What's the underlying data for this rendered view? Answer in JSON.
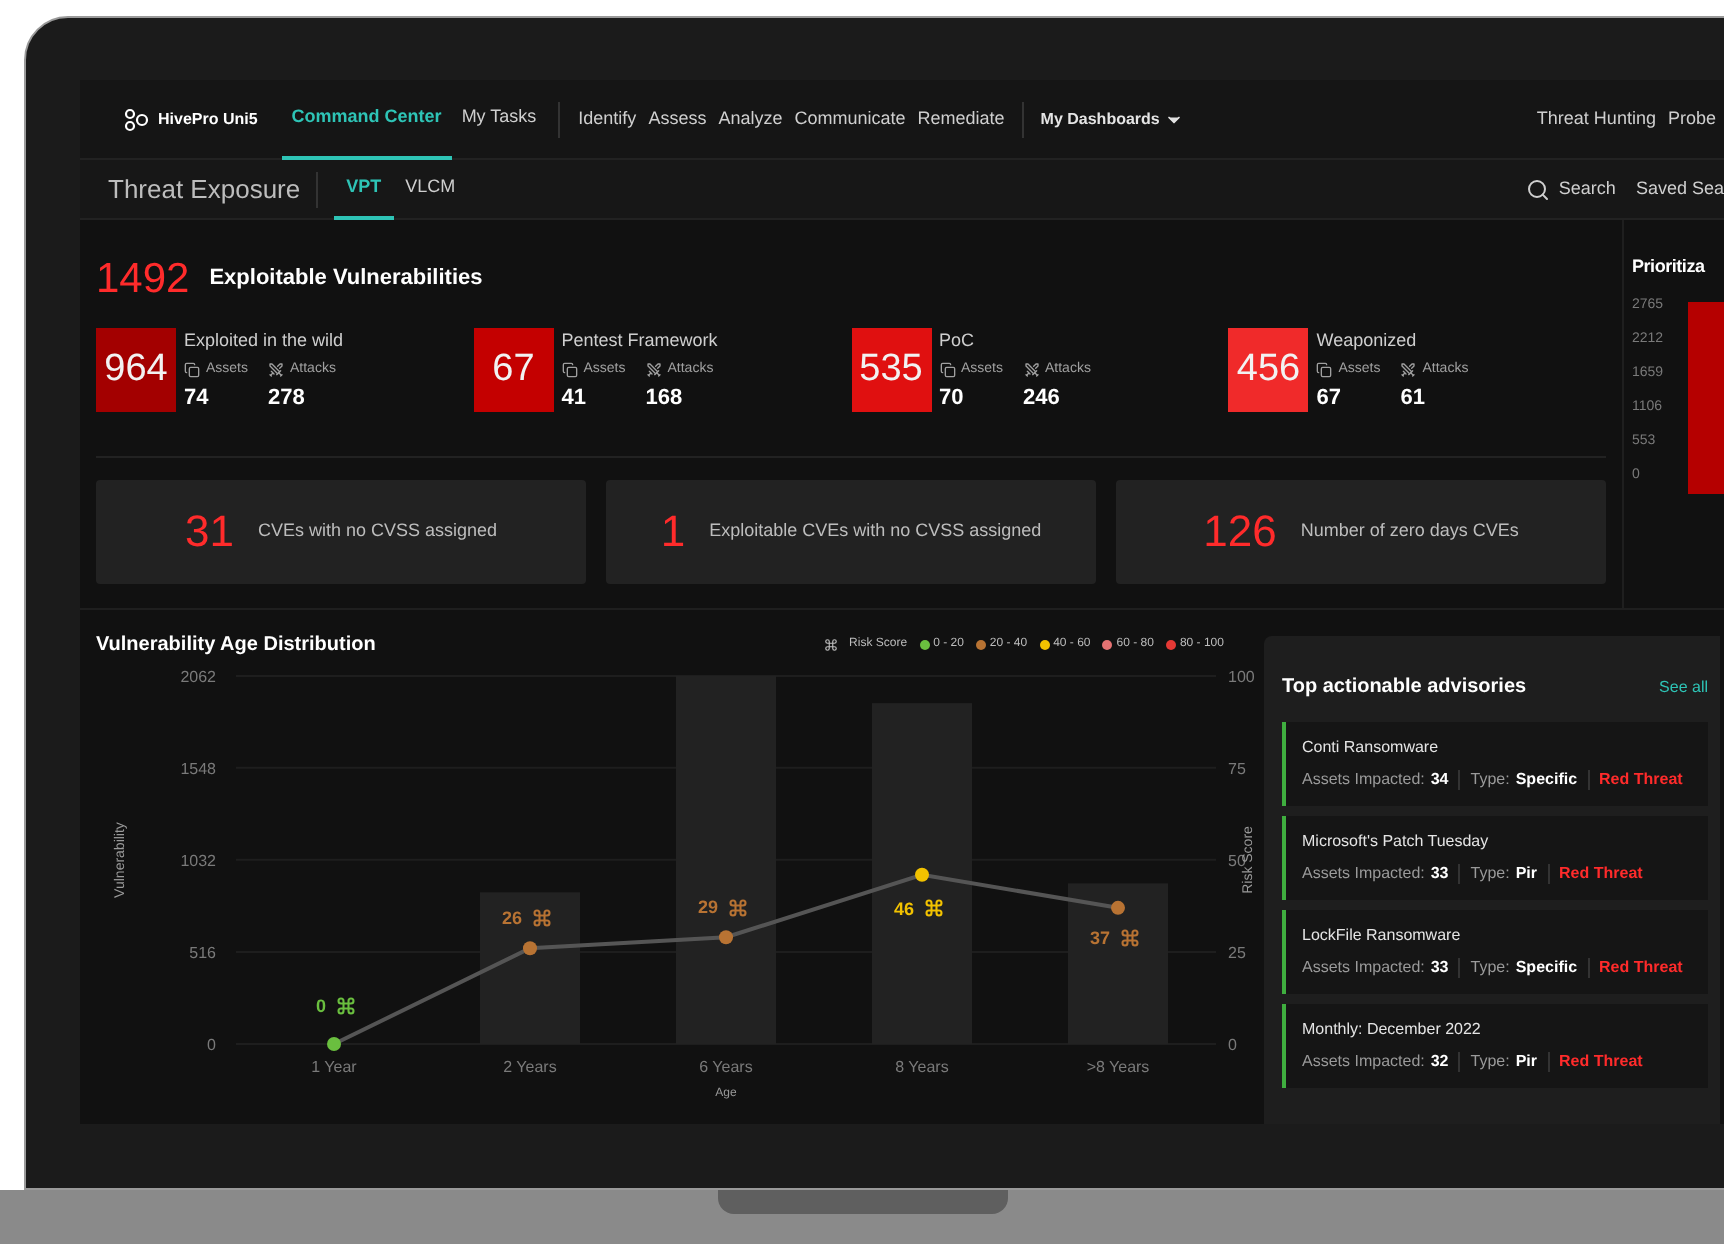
{
  "nav": {
    "brand": "HivePro Uni5",
    "tabs": [
      {
        "label": "Command Center",
        "selected": true
      },
      {
        "label": "My Tasks",
        "selected": false
      }
    ],
    "modules": [
      "Identify",
      "Assess",
      "Analyze",
      "Communicate",
      "Remediate"
    ],
    "dashboards": "My Dashboards",
    "right_links": [
      "Threat Hunting",
      "Probe"
    ]
  },
  "subnav": {
    "title": "Threat Exposure",
    "tabs": [
      {
        "label": "VPT",
        "selected": true
      },
      {
        "label": "VLCM",
        "selected": false
      }
    ],
    "search": "Search",
    "saved": "Saved Sea"
  },
  "summary": {
    "total": "1492",
    "title": "Exploitable Vulnerabilities",
    "cards": [
      {
        "count": "964",
        "label": "Exploited in the wild",
        "assets_label": "Assets",
        "attacks_label": "Attacks",
        "assets": "74",
        "attacks": "278",
        "color": "#a30000"
      },
      {
        "count": "67",
        "label": "Pentest Framework",
        "assets_label": "Assets",
        "attacks_label": "Attacks",
        "assets": "41",
        "attacks": "168",
        "color": "#c40000"
      },
      {
        "count": "535",
        "label": "PoC",
        "assets_label": "Assets",
        "attacks_label": "Attacks",
        "assets": "70",
        "attacks": "246",
        "color": "#e01010"
      },
      {
        "count": "456",
        "label": "Weaponized",
        "assets_label": "Assets",
        "attacks_label": "Attacks",
        "assets": "67",
        "attacks": "61",
        "color": "#f02a2a"
      }
    ],
    "stats": [
      {
        "value": "31",
        "label": "CVEs with no CVSS assigned"
      },
      {
        "value": "1",
        "label": "Exploitable CVEs with no CVSS assigned"
      },
      {
        "value": "126",
        "label": "Number of zero days CVEs"
      }
    ]
  },
  "prioritization": {
    "title": "Prioritiza",
    "yticks": [
      "2765",
      "2212",
      "1659",
      "1106",
      "553",
      "0"
    ]
  },
  "age_chart": {
    "title": "Vulnerability Age Distribution",
    "legend_title": "Risk Score",
    "legend": [
      {
        "label": "0 - 20",
        "color": "#6abf3f"
      },
      {
        "label": "20 - 40",
        "color": "#b87333"
      },
      {
        "label": "40 - 60",
        "color": "#f2c200"
      },
      {
        "label": "60 - 80",
        "color": "#e57373"
      },
      {
        "label": "80 - 100",
        "color": "#e53935"
      }
    ],
    "chart_data": {
      "type": "bar",
      "xlabel": "Age",
      "grid": true,
      "categories": [
        "1 Year",
        "2 Years",
        "6 Years",
        "8 Years",
        ">8 Years"
      ],
      "series": [
        {
          "name": "Vulnerability",
          "color": "#222222",
          "values": [
            0,
            850,
            2062,
            1910,
            900
          ]
        }
      ],
      "ylim": [
        0,
        2062
      ],
      "yticks": [
        0,
        516,
        1032,
        1548,
        2062
      ]
    },
    "risk_line": {
      "chart_data": {
        "type": "line",
        "series": [
          {
            "name": "Risk Score",
            "color": "#555555",
            "marker": "circle",
            "values": [
              0,
              26,
              29,
              46,
              37
            ]
          }
        ],
        "ylim": [
          0,
          100
        ],
        "yticks": [
          0,
          25,
          50,
          75,
          100
        ],
        "value_labels": [
          "0",
          "26",
          "29",
          "46",
          "37"
        ]
      }
    }
  },
  "advisories": {
    "title": "Top actionable advisories",
    "see_all": "See all",
    "items": [
      {
        "name": "Conti Ransomware",
        "assets_label": "Assets Impacted:",
        "assets": "34",
        "type_label": "Type:",
        "type": "Specific",
        "threat": "Red Threat"
      },
      {
        "name": "Microsoft's Patch Tuesday",
        "assets_label": "Assets Impacted:",
        "assets": "33",
        "type_label": "Type:",
        "type": "Pir",
        "threat": "Red Threat"
      },
      {
        "name": "LockFile Ransomware",
        "assets_label": "Assets Impacted:",
        "assets": "33",
        "type_label": "Type:",
        "type": "Specific",
        "threat": "Red Threat"
      },
      {
        "name": "Monthly: December 2022",
        "assets_label": "Assets Impacted:",
        "assets": "32",
        "type_label": "Type:",
        "type": "Pir",
        "threat": "Red Threat"
      }
    ]
  }
}
